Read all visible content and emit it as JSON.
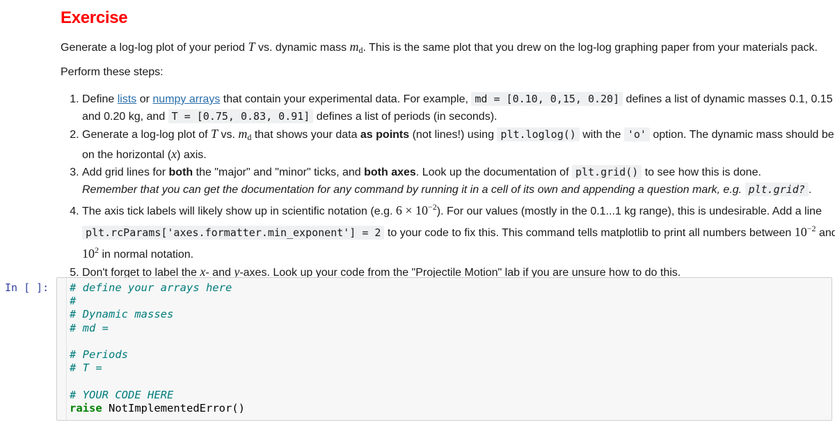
{
  "markdown": {
    "title": "Exercise",
    "intro": {
      "text1": "Generate a log-log plot of your period ",
      "var_T": "T",
      "text2": " vs. dynamic mass ",
      "var_m": "m",
      "var_m_sub": "d",
      "text3": ". This is the same plot that you drew on the log-log graphing paper from your materials pack."
    },
    "perform": "Perform these steps:",
    "steps": [
      {
        "t1": "Define ",
        "link1": "lists",
        "t2": " or ",
        "link2": "numpy arrays",
        "t3": " that contain your experimental data. For example, ",
        "code1": "md = [0.10, 0,15, 0.20]",
        "t4": " defines a list of dynamic masses 0.1, 0.15 and 0.20 kg, and ",
        "code2": "T = [0.75, 0.83, 0.91]",
        "t5": " defines a list of periods (in seconds)."
      },
      {
        "t1": "Generate a log-log plot of ",
        "var_T": "T",
        "t2": " vs. ",
        "var_m": "m",
        "var_m_sub": "d",
        "t3": " that shows your data ",
        "bold1": "as points",
        "t4": " (not lines!) using ",
        "code1": "plt.loglog()",
        "t5": " with the ",
        "code2": "'o'",
        "t6": " option. The dynamic mass should be on the horizontal (",
        "var_x": "x",
        "t7": ") axis."
      },
      {
        "t1": "Add grid lines for ",
        "bold1": "both",
        "t2": " the \"major\" and \"minor\" ticks, and ",
        "bold2": "both axes",
        "t3": ". Look up the documentation of ",
        "code1": "plt.grid()",
        "t4": " to see how this is done.",
        "italic1": "Remember that you can get the documentation for any command by running it in a cell of its own and appending a question mark, e.g. ",
        "code2": "plt.grid?",
        "t5": "."
      },
      {
        "t1": "The axis tick labels will likely show up in scientific notation (e.g. ",
        "math1": "6 × 10",
        "math1_sup": "−2",
        "t2": "). For our values (mostly in the 0.1...1 kg range), this is undesirable. Add a line ",
        "code1": "plt.rcParams['axes.formatter.min_exponent'] = 2",
        "t3": " to your code to fix this. This command tells matplotlib to print all numbers between ",
        "math2": "10",
        "math2_sup": "−2",
        "t4": " and ",
        "math3": "10",
        "math3_sup": "2",
        "t5": " in normal notation."
      },
      {
        "t1": "Don't forget to label the ",
        "var_x": "x",
        "t2": "- and ",
        "var_y": "y",
        "t3": "-axes. Look up your code from the \"Projectile Motion\" lab if you are unsure how to do this."
      }
    ]
  },
  "code_cell": {
    "prompt": "In [ ]:",
    "lines": [
      "# define your arrays here",
      "#",
      "# Dynamic masses",
      "# md =",
      "",
      "# Periods",
      "# T =",
      "",
      "# YOUR CODE HERE"
    ],
    "raise_kw": "raise",
    "raise_rest": " NotImplementedError()"
  }
}
